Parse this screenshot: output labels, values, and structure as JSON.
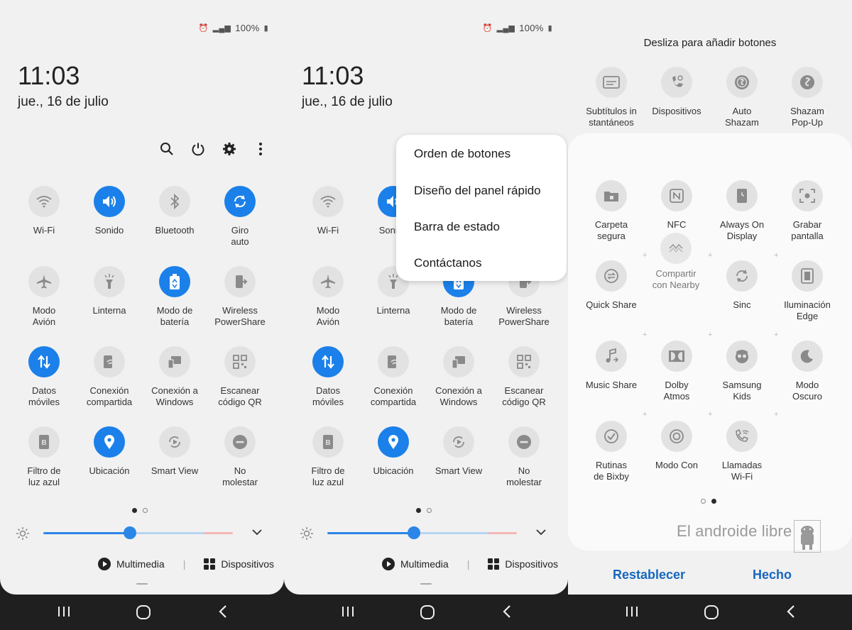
{
  "status": {
    "battery": "100%"
  },
  "panel1": {
    "time": "11:03",
    "date": "jue., 16 de julio",
    "tiles": [
      {
        "label": "Wi-Fi",
        "on": false,
        "icon": "wifi-icon"
      },
      {
        "label": "Sonido",
        "on": true,
        "icon": "volume-icon"
      },
      {
        "label": "Bluetooth",
        "on": false,
        "icon": "bluetooth-icon"
      },
      {
        "label": "Giro\nauto",
        "on": true,
        "icon": "rotate-icon"
      },
      {
        "label": "Modo\nAvión",
        "on": false,
        "icon": "airplane-icon"
      },
      {
        "label": "Linterna",
        "on": false,
        "icon": "flashlight-icon"
      },
      {
        "label": "Modo de\nbatería",
        "on": true,
        "icon": "battery-icon"
      },
      {
        "label": "Wireless\nPowerShare",
        "on": false,
        "icon": "powershare-icon"
      },
      {
        "label": "Datos\nmóviles",
        "on": true,
        "icon": "data-icon"
      },
      {
        "label": "Conexión\ncompartida",
        "on": false,
        "icon": "hotspot-icon"
      },
      {
        "label": "Conexión a\nWindows",
        "on": false,
        "icon": "windows-link-icon"
      },
      {
        "label": "Escanear\ncódigo QR",
        "on": false,
        "icon": "qr-icon"
      },
      {
        "label": "Filtro de\nluz azul",
        "on": false,
        "icon": "bluelight-icon"
      },
      {
        "label": "Ubicación",
        "on": true,
        "icon": "location-icon"
      },
      {
        "label": "Smart View",
        "on": false,
        "icon": "smartview-icon"
      },
      {
        "label": "No\nmolestar",
        "on": false,
        "icon": "dnd-icon"
      }
    ],
    "multimedia": "Multimedia",
    "devices": "Dispositivos"
  },
  "panel2": {
    "time": "11:03",
    "date": "jue., 16 de julio",
    "menu": [
      "Orden de botones",
      "Diseño del panel rápido",
      "Barra de estado",
      "Contáctanos"
    ]
  },
  "panel3": {
    "hint": "Desliza para añadir botones",
    "available": [
      {
        "label": "Subtítulos in\nstantáneos",
        "icon": "subtitles-icon"
      },
      {
        "label": "Dispositivos",
        "icon": "devices-icon"
      },
      {
        "label": "Auto\nShazam",
        "icon": "shazam-icon"
      },
      {
        "label": "Shazam\nPop-Up",
        "icon": "shazam-popup-icon"
      }
    ],
    "hidden_tiles": [
      {
        "label": "Carpeta\nsegura",
        "icon": "secure-folder-icon"
      },
      {
        "label": "NFC",
        "icon": "nfc-icon"
      },
      {
        "label": "Always On\nDisplay",
        "icon": "aod-icon"
      },
      {
        "label": "Grabar\npantalla",
        "icon": "screen-record-icon"
      },
      {
        "label": "Quick Share",
        "icon": "quick-share-icon"
      },
      {
        "label": "",
        "icon": "placeholder-icon"
      },
      {
        "label": "Sinc",
        "icon": "sync-icon"
      },
      {
        "label": "Iluminación\nEdge",
        "icon": "edge-light-icon"
      },
      {
        "label": "Music Share",
        "icon": "music-share-icon"
      },
      {
        "label": "Dolby\nAtmos",
        "icon": "dolby-icon"
      },
      {
        "label": "Samsung\nKids",
        "icon": "kids-icon"
      },
      {
        "label": "Modo\nOscuro",
        "icon": "dark-mode-icon"
      },
      {
        "label": "Rutinas\nde Bixby",
        "icon": "routines-icon"
      },
      {
        "label": "Modo Con",
        "icon": "focus-mode-icon"
      },
      {
        "label": "Llamadas\nWi-Fi",
        "icon": "wifi-call-icon"
      }
    ],
    "dragging": "Compartir\ncon Nearby",
    "reset": "Restablecer",
    "done": "Hecho",
    "watermark": "El androide libre"
  }
}
